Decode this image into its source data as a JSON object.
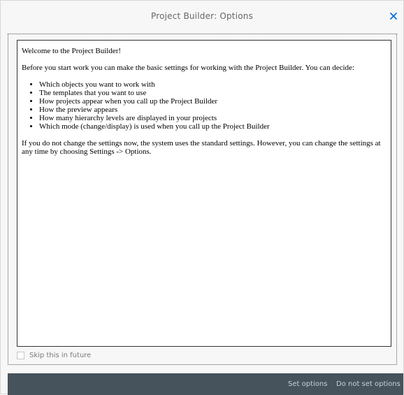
{
  "dialog": {
    "title": "Project Builder: Options",
    "close_icon": "close-icon",
    "accent_color": "#0a6ed1"
  },
  "content": {
    "greeting": "Welcome to the Project Builder!",
    "intro": "Before you start work you can make the basic settings for working with the Project Builder. You can decide:",
    "options": [
      "Which objects you want to work with",
      "The templates that you want to use",
      "How projects appear when you call up the Project Builder",
      "How the preview appears",
      "How many hierarchy levels are displayed in your projects",
      "Which mode (change/display) is used when you call up the Project Builder"
    ],
    "note": "If you do not change the settings now, the system uses the standard settings. However, you can change the settings at any time by choosing Settings -> Options."
  },
  "skip": {
    "label": "Skip this in future",
    "checked": false
  },
  "footer": {
    "set_options_label": "Set options",
    "do_not_set_options_label": "Do not set options",
    "background_color": "#46525c"
  }
}
